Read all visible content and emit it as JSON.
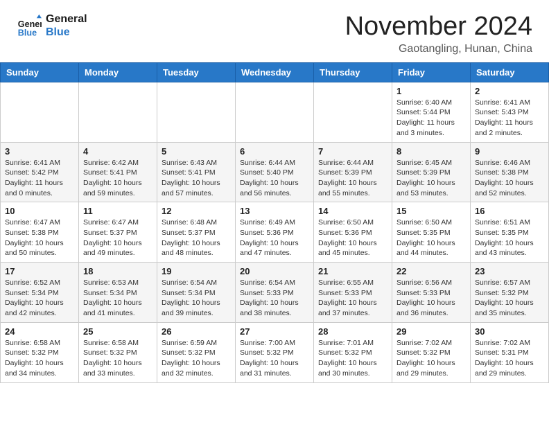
{
  "header": {
    "logo_line1": "General",
    "logo_line2": "Blue",
    "month": "November 2024",
    "location": "Gaotangling, Hunan, China"
  },
  "weekdays": [
    "Sunday",
    "Monday",
    "Tuesday",
    "Wednesday",
    "Thursday",
    "Friday",
    "Saturday"
  ],
  "weeks": [
    [
      {
        "day": "",
        "info": ""
      },
      {
        "day": "",
        "info": ""
      },
      {
        "day": "",
        "info": ""
      },
      {
        "day": "",
        "info": ""
      },
      {
        "day": "",
        "info": ""
      },
      {
        "day": "1",
        "info": "Sunrise: 6:40 AM\nSunset: 5:44 PM\nDaylight: 11 hours\nand 3 minutes."
      },
      {
        "day": "2",
        "info": "Sunrise: 6:41 AM\nSunset: 5:43 PM\nDaylight: 11 hours\nand 2 minutes."
      }
    ],
    [
      {
        "day": "3",
        "info": "Sunrise: 6:41 AM\nSunset: 5:42 PM\nDaylight: 11 hours\nand 0 minutes."
      },
      {
        "day": "4",
        "info": "Sunrise: 6:42 AM\nSunset: 5:41 PM\nDaylight: 10 hours\nand 59 minutes."
      },
      {
        "day": "5",
        "info": "Sunrise: 6:43 AM\nSunset: 5:41 PM\nDaylight: 10 hours\nand 57 minutes."
      },
      {
        "day": "6",
        "info": "Sunrise: 6:44 AM\nSunset: 5:40 PM\nDaylight: 10 hours\nand 56 minutes."
      },
      {
        "day": "7",
        "info": "Sunrise: 6:44 AM\nSunset: 5:39 PM\nDaylight: 10 hours\nand 55 minutes."
      },
      {
        "day": "8",
        "info": "Sunrise: 6:45 AM\nSunset: 5:39 PM\nDaylight: 10 hours\nand 53 minutes."
      },
      {
        "day": "9",
        "info": "Sunrise: 6:46 AM\nSunset: 5:38 PM\nDaylight: 10 hours\nand 52 minutes."
      }
    ],
    [
      {
        "day": "10",
        "info": "Sunrise: 6:47 AM\nSunset: 5:38 PM\nDaylight: 10 hours\nand 50 minutes."
      },
      {
        "day": "11",
        "info": "Sunrise: 6:47 AM\nSunset: 5:37 PM\nDaylight: 10 hours\nand 49 minutes."
      },
      {
        "day": "12",
        "info": "Sunrise: 6:48 AM\nSunset: 5:37 PM\nDaylight: 10 hours\nand 48 minutes."
      },
      {
        "day": "13",
        "info": "Sunrise: 6:49 AM\nSunset: 5:36 PM\nDaylight: 10 hours\nand 47 minutes."
      },
      {
        "day": "14",
        "info": "Sunrise: 6:50 AM\nSunset: 5:36 PM\nDaylight: 10 hours\nand 45 minutes."
      },
      {
        "day": "15",
        "info": "Sunrise: 6:50 AM\nSunset: 5:35 PM\nDaylight: 10 hours\nand 44 minutes."
      },
      {
        "day": "16",
        "info": "Sunrise: 6:51 AM\nSunset: 5:35 PM\nDaylight: 10 hours\nand 43 minutes."
      }
    ],
    [
      {
        "day": "17",
        "info": "Sunrise: 6:52 AM\nSunset: 5:34 PM\nDaylight: 10 hours\nand 42 minutes."
      },
      {
        "day": "18",
        "info": "Sunrise: 6:53 AM\nSunset: 5:34 PM\nDaylight: 10 hours\nand 41 minutes."
      },
      {
        "day": "19",
        "info": "Sunrise: 6:54 AM\nSunset: 5:34 PM\nDaylight: 10 hours\nand 39 minutes."
      },
      {
        "day": "20",
        "info": "Sunrise: 6:54 AM\nSunset: 5:33 PM\nDaylight: 10 hours\nand 38 minutes."
      },
      {
        "day": "21",
        "info": "Sunrise: 6:55 AM\nSunset: 5:33 PM\nDaylight: 10 hours\nand 37 minutes."
      },
      {
        "day": "22",
        "info": "Sunrise: 6:56 AM\nSunset: 5:33 PM\nDaylight: 10 hours\nand 36 minutes."
      },
      {
        "day": "23",
        "info": "Sunrise: 6:57 AM\nSunset: 5:32 PM\nDaylight: 10 hours\nand 35 minutes."
      }
    ],
    [
      {
        "day": "24",
        "info": "Sunrise: 6:58 AM\nSunset: 5:32 PM\nDaylight: 10 hours\nand 34 minutes."
      },
      {
        "day": "25",
        "info": "Sunrise: 6:58 AM\nSunset: 5:32 PM\nDaylight: 10 hours\nand 33 minutes."
      },
      {
        "day": "26",
        "info": "Sunrise: 6:59 AM\nSunset: 5:32 PM\nDaylight: 10 hours\nand 32 minutes."
      },
      {
        "day": "27",
        "info": "Sunrise: 7:00 AM\nSunset: 5:32 PM\nDaylight: 10 hours\nand 31 minutes."
      },
      {
        "day": "28",
        "info": "Sunrise: 7:01 AM\nSunset: 5:32 PM\nDaylight: 10 hours\nand 30 minutes."
      },
      {
        "day": "29",
        "info": "Sunrise: 7:02 AM\nSunset: 5:32 PM\nDaylight: 10 hours\nand 29 minutes."
      },
      {
        "day": "30",
        "info": "Sunrise: 7:02 AM\nSunset: 5:31 PM\nDaylight: 10 hours\nand 29 minutes."
      }
    ]
  ]
}
